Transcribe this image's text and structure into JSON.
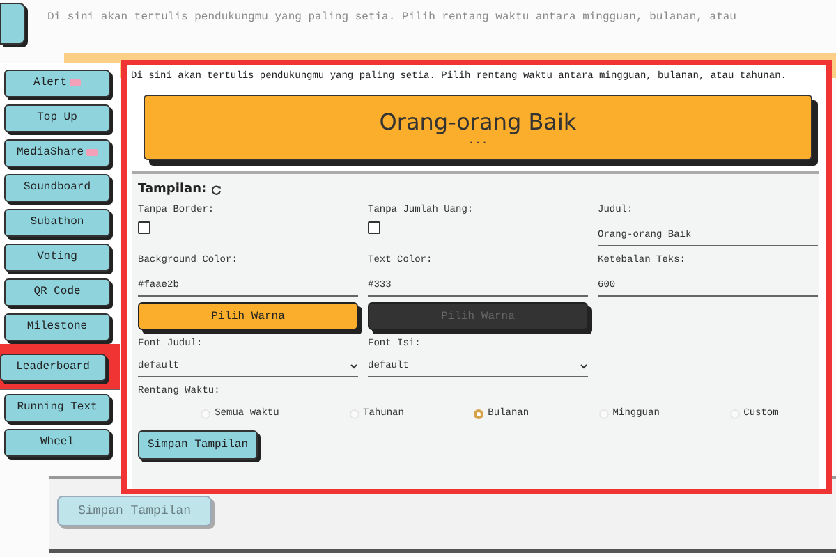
{
  "backdrop": {
    "description": "Di sini akan tertulis pendukungmu yang paling setia. Pilih rentang waktu antara mingguan, bulanan, atau",
    "save_button": "Simpan Tampilan"
  },
  "sidebar": {
    "items": [
      {
        "label": "Alert",
        "badge": true,
        "selected": false
      },
      {
        "label": "Top Up",
        "badge": false,
        "selected": false
      },
      {
        "label": "MediaShare",
        "badge": true,
        "selected": false
      },
      {
        "label": "Soundboard",
        "badge": false,
        "selected": false
      },
      {
        "label": "Subathon",
        "badge": false,
        "selected": false
      },
      {
        "label": "Voting",
        "badge": false,
        "selected": false
      },
      {
        "label": "QR Code",
        "badge": false,
        "selected": false
      },
      {
        "label": "Milestone",
        "badge": false,
        "selected": false
      },
      {
        "label": "Leaderboard",
        "badge": false,
        "selected": true
      },
      {
        "label": "Running Text",
        "badge": false,
        "selected": false
      },
      {
        "label": "Wheel",
        "badge": false,
        "selected": false
      }
    ]
  },
  "panel": {
    "description": "Di sini akan tertulis pendukungmu yang paling setia. Pilih rentang waktu antara mingguan, bulanan, atau tahunan.",
    "preview": {
      "title": "Orang-orang Baik",
      "body": "...",
      "color": "#faae2b"
    },
    "settings": {
      "heading": "Tampilan:",
      "rows": [
        [
          {
            "kind": "checkbox",
            "label": "Tanpa Border:",
            "checked": false
          },
          {
            "kind": "checkbox",
            "label": "Tanpa Jumlah Uang:",
            "checked": false
          },
          {
            "kind": "text",
            "label": "Judul:",
            "value": "Orang-orang Baik"
          }
        ],
        [
          {
            "kind": "text",
            "label": "Background Color:",
            "value": "#faae2b"
          },
          {
            "kind": "text",
            "label": "Text Color:",
            "value": "#333"
          },
          {
            "kind": "text",
            "label": "Ketebalan Teks:",
            "value": "600"
          }
        ],
        [
          {
            "kind": "color_button",
            "label": "Pilih Warna",
            "color": "#faae2b"
          },
          {
            "kind": "color_button",
            "label": "Pilih Warna",
            "color": "#333333"
          }
        ],
        [
          {
            "kind": "select",
            "label": "Font Judul:",
            "value": "default"
          },
          {
            "kind": "select",
            "label": "Font Isi:",
            "value": "default"
          }
        ]
      ],
      "time_range": {
        "label": "Rentang Waktu:",
        "options": [
          {
            "label": "Semua waktu",
            "selected": false
          },
          {
            "label": "Tahunan",
            "selected": false
          },
          {
            "label": "Bulanan",
            "selected": true
          },
          {
            "label": "Mingguan",
            "selected": false
          },
          {
            "label": "Custom",
            "selected": false
          }
        ]
      },
      "save_button": "Simpan Tampilan"
    }
  }
}
